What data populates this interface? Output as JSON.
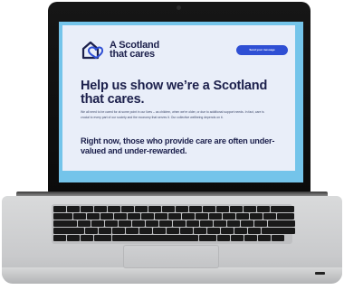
{
  "site": {
    "logo": {
      "line1": "A Scotland",
      "line2": "that cares"
    },
    "cta_label": "Send your message",
    "headline": "Help us show we’re a Scotland that cares.",
    "body": "We all need to be cared for at some point in our lives – as children, when we’re older, or due to additional support needs. In fact, care is crucial to every part of our society and the economy that serves it. Our collective wellbeing depends on it.",
    "subhead": "Right now, those who provide care are often under-valued and under-rewarded."
  },
  "colors": {
    "navy": "#1b1f4b",
    "button": "#2f4fd4",
    "page_bg": "#e9eef9",
    "frame_blue": "#74c4ea"
  },
  "icons": {
    "logo": "heart-house-logo-icon"
  }
}
